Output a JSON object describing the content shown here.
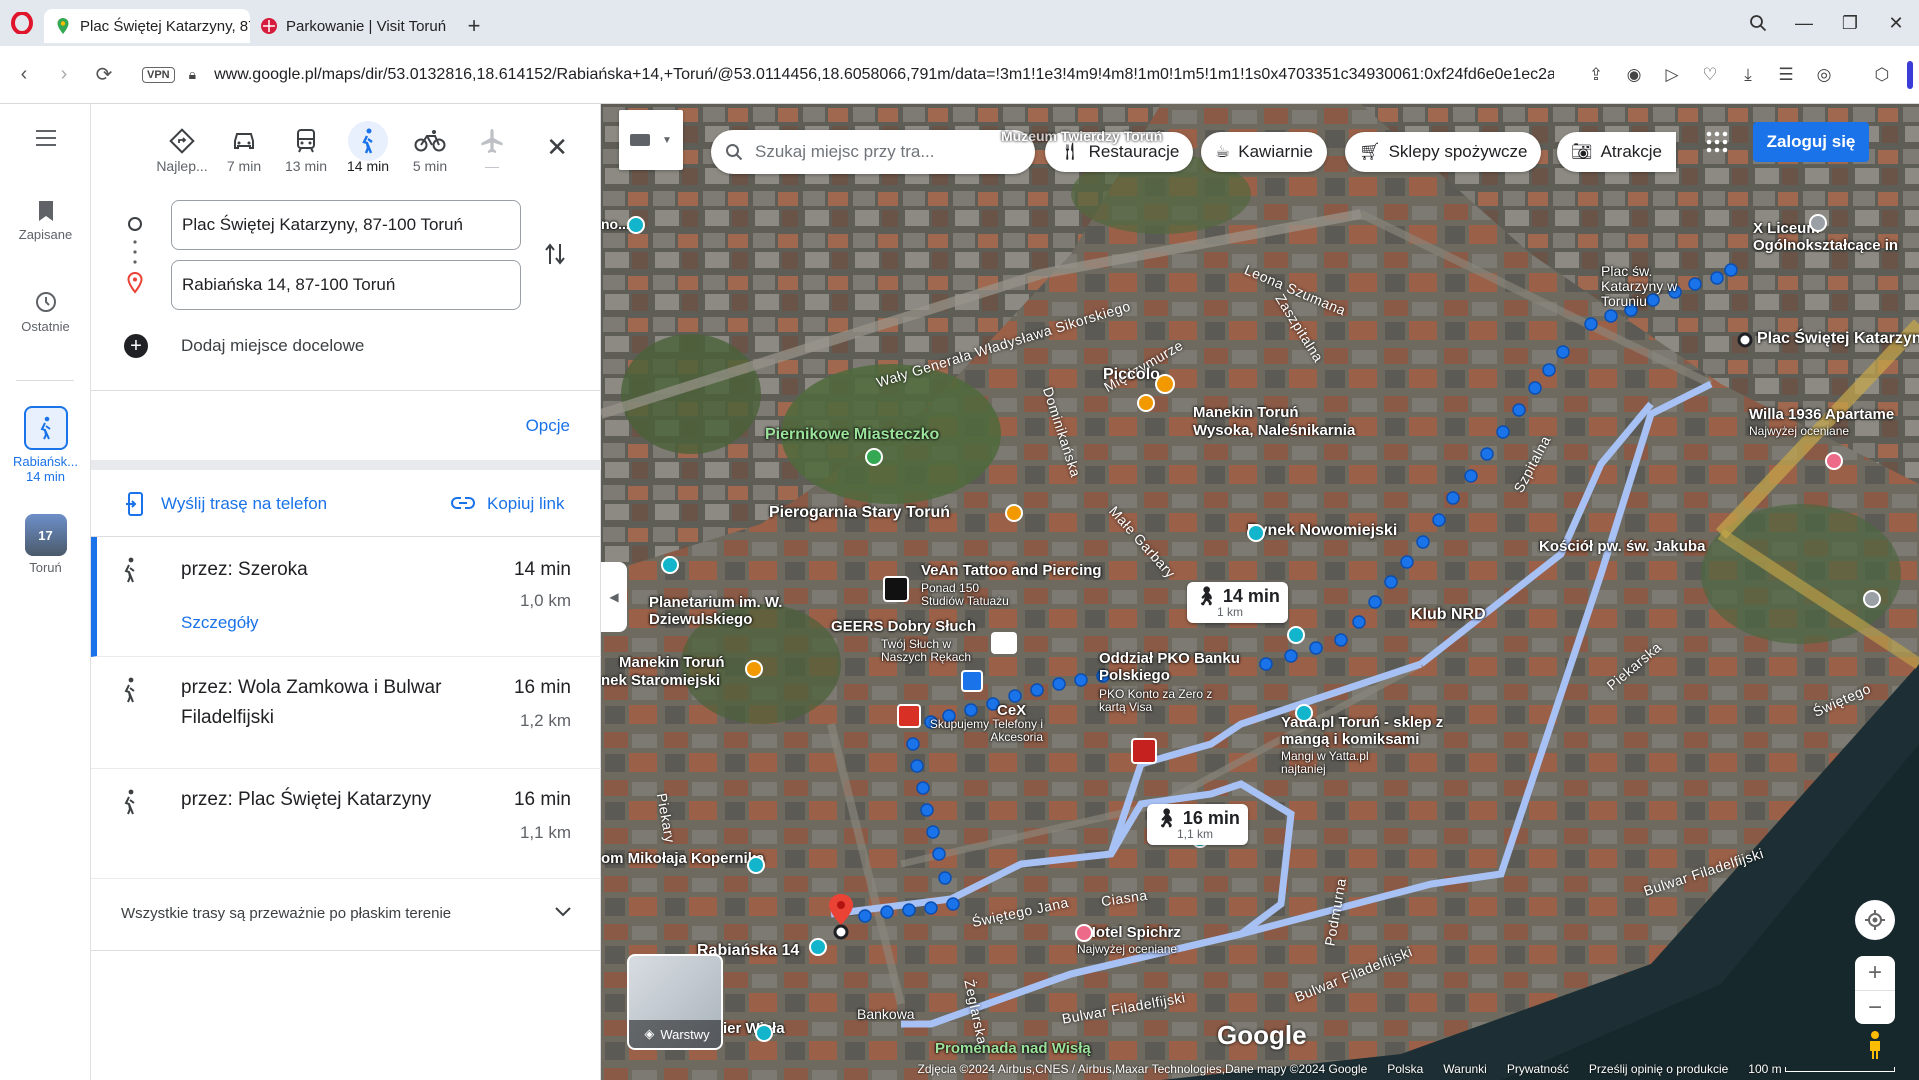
{
  "browser": {
    "tabs": [
      {
        "title": "Plac Świętej Katarzyny, 87",
        "active": true
      },
      {
        "title": "Parkowanie | Visit Toruń",
        "active": false
      }
    ],
    "url": "www.google.pl/maps/dir/53.0132816,18.614152/Rabiańska+14,+Toruń/@53.0114456,18.6058066,791m/data=!3m1!1e3!4m9!4m8!1m0!1m5!1m1!1s0x4703351c34930061:0xf24fd6e0e1ec2a",
    "vpn_label": "VPN"
  },
  "rail": {
    "saved": "Zapisane",
    "recent": "Ostatnie",
    "recent_trip_label": "Rabiańsk...",
    "recent_trip_time": "14 min",
    "city_label": "Toruń",
    "city_badge": "17"
  },
  "modes": [
    {
      "name": "best",
      "label": "Najlep..."
    },
    {
      "name": "car",
      "label": "7 min"
    },
    {
      "name": "transit",
      "label": "13 min"
    },
    {
      "name": "walk",
      "label": "14 min",
      "selected": true
    },
    {
      "name": "bike",
      "label": "5 min"
    },
    {
      "name": "flight",
      "label": "—"
    }
  ],
  "directions": {
    "origin": "Plac Świętej Katarzyny, 87-100 Toruń",
    "destination": "Rabiańska 14, 87-100 Toruń",
    "add_destination": "Dodaj miejsce docelowe",
    "options": "Opcje",
    "send_to_phone": "Wyślij trasę na telefon",
    "copy_link": "Kopiuj link"
  },
  "routes": [
    {
      "name": "przez: Szeroka",
      "time": "14 min",
      "distance": "1,0 km",
      "details": "Szczegóły"
    },
    {
      "name": "przez: Wola Zamkowa i Bulwar Filadelfijski",
      "time": "16 min",
      "distance": "1,2 km"
    },
    {
      "name": "przez: Plac Świętej Katarzyny",
      "time": "16 min",
      "distance": "1,1 km"
    }
  ],
  "terrain_note": "Wszystkie trasy są przeważnie po płaskim terenie",
  "map": {
    "search_placeholder": "Szukaj miejsc przy tra...",
    "chips": [
      "Restauracje",
      "Kawiarnie",
      "Sklepy spożywcze",
      "Atrakcje"
    ],
    "login": "Zaloguj się",
    "layers": "Warstwy",
    "bubble_1_time": "14 min",
    "bubble_1_dist": "1 km",
    "bubble_2_time": "16 min",
    "bubble_2_dist": "1,1 km",
    "places": {
      "origin": "Plac Świętej Katarzyny",
      "destination": "Rabiańska 14",
      "piccolo": "Piccolo",
      "manekin1": "Manekin Toruń",
      "manekin1_sub": "Wysoka, Naleśnikarnia",
      "piernikowe": "Piernikowe Miasteczko",
      "piernikarnia": "Pierogarnia Stary Toruń",
      "vean": "VeAn Tattoo and Piercing",
      "vean_sub": "Ponad 150 Studiów Tatuażu",
      "rynek": "Rynek Nowomiejski",
      "klub": "Klub NRD",
      "geers": "GEERS Dobry Słuch",
      "geers_sub": "Twój Słuch w Naszych Rękach",
      "planetarium": "Planetarium im. W. Dziewulskiego",
      "manekin2": "Manekin Toruń",
      "manekin2_sub": "nek Staromiejski",
      "pko": "Oddział PKO Banku Polskiego",
      "pko_sub": "PKO Konto za Zero z kartą Visa",
      "cex": "CeX",
      "cex_sub": "Skupujemy Telefony i Akcesoria",
      "yatta": "Yatta.pl Toruń - sklep z mangą i komiksami",
      "yatta_sub": "Mangi w Yatta.pl najtaniej",
      "kosciol": "Kościół pw. św. Jakuba",
      "plac_sw": "Plac św. Katarzyny w Toruniu",
      "liceum": "X Liceum Ogólnokształcące in",
      "willa": "Willa 1936 Apartame",
      "willa_sub": "Najwyżej oceniane",
      "spichrz": "Hotel Spichrz",
      "spichrz_sub": "Najwyżej oceniane",
      "kopernik": "om Mikołaja Kopernika",
      "bankowa": "Bankowa",
      "wisla": "Promenada nad Wisłą",
      "nadwisla": "ier Wisła",
      "muzeum": "Muzeum Twierdzy Toruń"
    },
    "streets": {
      "waly": "Wały Generała Władysława Sikorskiego",
      "szumana": "Leona Szumana",
      "miedzymurze": "Międzymurze",
      "dominikanska": "Dominikańska",
      "malegarbary": "Małe Garbary",
      "zaszpitalna": "Zaszpitalna",
      "szpitalna": "Szpitalna",
      "piekarska": "Piekarska",
      "podmurna": "Podmurna",
      "sw_jana": "Świętego Jana",
      "ciasna": "Ciasna",
      "zeglarska": "Żeglarska",
      "piekary": "Piekary",
      "bulwar1": "Bulwar Filadelfijski",
      "bulwar2": "Bulwar Filadelfijski",
      "bulwar3": "Bulwar Filadelfijski",
      "swietego": "Świętego",
      "muzeum_short": "no..."
    },
    "attribution": "Zdjęcia ©2024 Airbus,CNES / Airbus,Maxar Technologies,Dane mapy ©2024 Google",
    "footer_links": [
      "Polska",
      "Warunki",
      "Prywatność",
      "Prześlij opinię o produkcie"
    ],
    "scale": "100 m",
    "google": "Google"
  },
  "colors": {
    "accent": "#1a73e8",
    "route_dots": "#1a73e8",
    "route_alt": "#a8c1f5"
  }
}
